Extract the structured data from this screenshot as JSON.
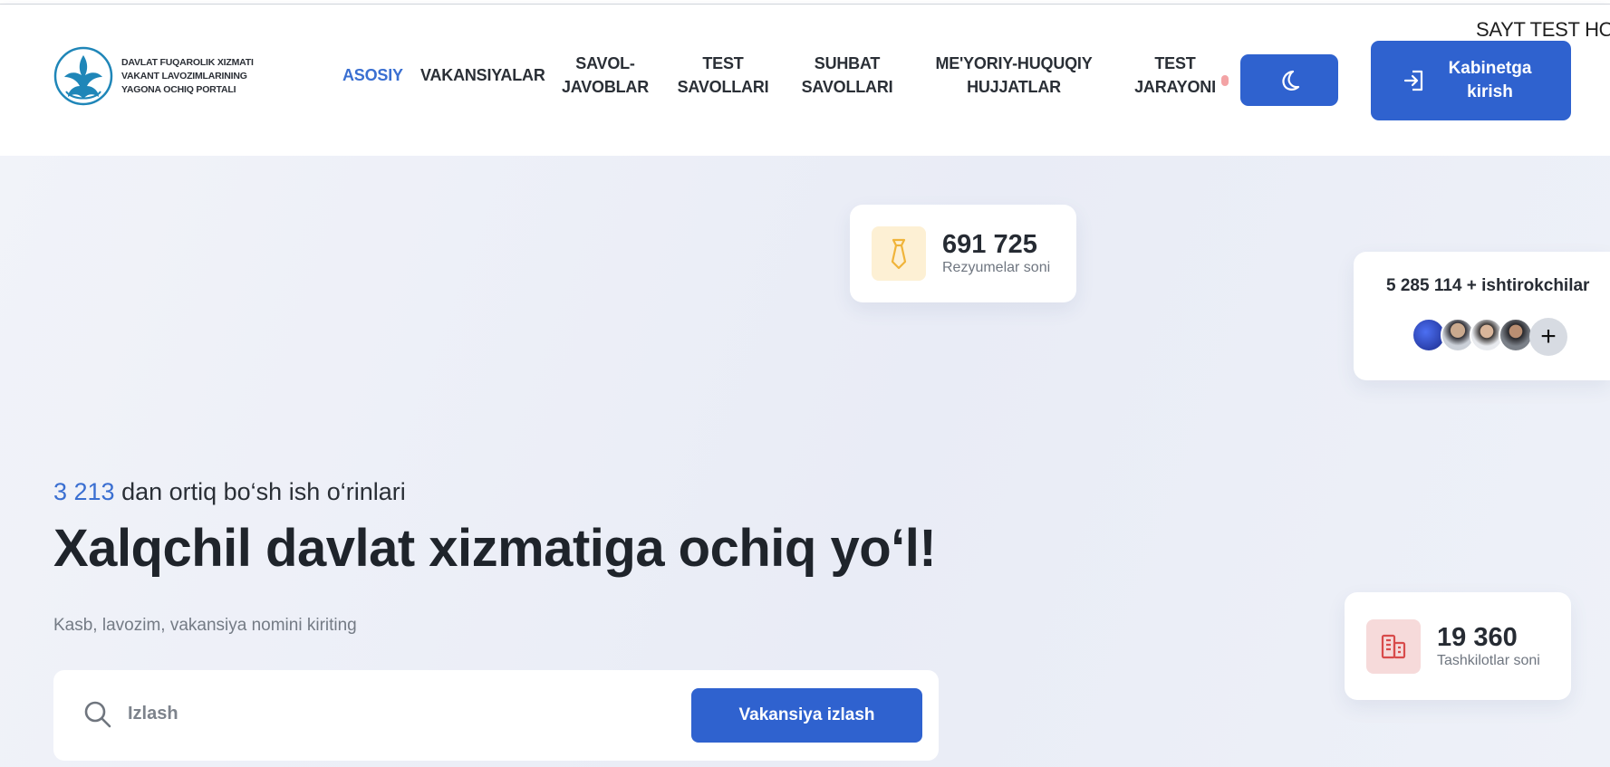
{
  "marquee": "SAYT TEST HOLATIDA",
  "logo": {
    "text": "DAVLAT FUQAROLIK XIZMATI VAKANT LAVOZIMLARINING YAGONA OCHIQ PORTALI"
  },
  "nav": {
    "home": "ASOSIY",
    "vacancies": "VAKANSIYALAR",
    "faq": "SAVOL-JAVOBLAR",
    "test_questions": "TEST SAVOLLARI",
    "interview_questions": "SUHBAT SAVOLLARI",
    "legal_docs": "ME'YORIY-HUQUQIY HUJJATLAR",
    "test_process": "TEST JARAYONI"
  },
  "login_button": "Kabinetga kirish",
  "stats": {
    "resumes": {
      "value": "691 725",
      "label": "Rezyumelar soni"
    },
    "participants": {
      "text": "5 285 114 + ishtirokchilar"
    },
    "organizations": {
      "value": "19 360",
      "label": "Tashkilotlar soni"
    }
  },
  "hero": {
    "count": "3 213",
    "lead_rest": " dan ortiq bo‘sh ish o‘rinlari",
    "headline": "Xalqchil davlat xizmatiga ochiq yo‘l!",
    "hint": "Kasb, lavozim, vakansiya nomini kiriting"
  },
  "search": {
    "placeholder": "Izlash",
    "button": "Vakansiya izlash"
  },
  "colors": {
    "accent": "#2f62cf",
    "link_active": "#3a6fd1"
  }
}
